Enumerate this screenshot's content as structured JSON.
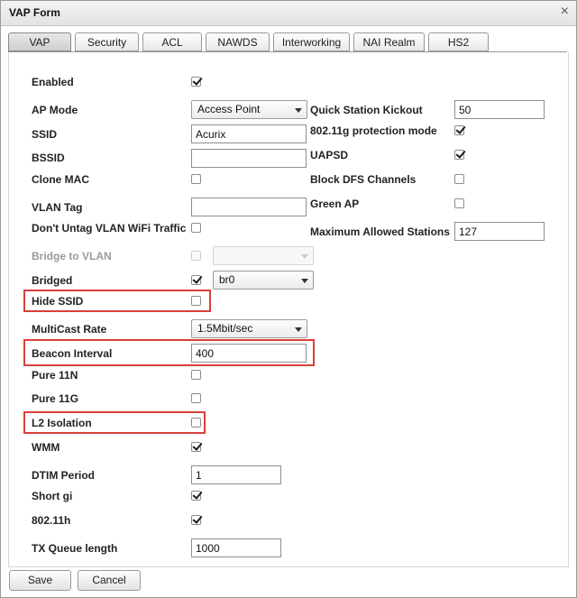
{
  "window": {
    "title": "VAP Form",
    "close_glyph": "×"
  },
  "tabs": [
    {
      "label": "VAP",
      "active": true
    },
    {
      "label": "Security"
    },
    {
      "label": "ACL"
    },
    {
      "label": "NAWDS"
    },
    {
      "label": "Interworking"
    },
    {
      "label": "NAI Realm"
    },
    {
      "label": "HS2"
    }
  ],
  "left": {
    "enabled": {
      "label": "Enabled",
      "checked": true
    },
    "ap_mode": {
      "label": "AP Mode",
      "value": "Access Point"
    },
    "ssid": {
      "label": "SSID",
      "value": "Acurix"
    },
    "bssid": {
      "label": "BSSID",
      "value": ""
    },
    "clone_mac": {
      "label": "Clone MAC",
      "checked": false
    },
    "vlan_tag": {
      "label": "VLAN Tag",
      "value": ""
    },
    "dont_untag": {
      "label": "Don't Untag VLAN WiFi Traffic",
      "checked": false
    },
    "bridge_to_vlan": {
      "label": "Bridge to VLAN",
      "checked": false,
      "disabled": true,
      "value": ""
    },
    "bridged": {
      "label": "Bridged",
      "checked": true,
      "value": "br0"
    },
    "hide_ssid": {
      "label": "Hide SSID",
      "checked": false
    },
    "multicast_rate": {
      "label": "MultiCast Rate",
      "value": "1.5Mbit/sec"
    },
    "beacon_interval": {
      "label": "Beacon Interval",
      "value": "400"
    },
    "pure_11n": {
      "label": "Pure 11N",
      "checked": false
    },
    "pure_11g": {
      "label": "Pure 11G",
      "checked": false
    },
    "l2_isolation": {
      "label": "L2 Isolation",
      "checked": false
    },
    "wmm": {
      "label": "WMM",
      "checked": true
    },
    "dtim_period": {
      "label": "DTIM Period",
      "value": "1"
    },
    "short_gi": {
      "label": "Short gi",
      "checked": true
    },
    "dot11h": {
      "label": "802.11h",
      "checked": true
    },
    "tx_queue_length": {
      "label": "TX Queue length",
      "value": "1000"
    }
  },
  "right": {
    "quick_station_kickout": {
      "label": "Quick Station Kickout",
      "value": "50"
    },
    "g_protection": {
      "label": "802.11g protection mode",
      "checked": true
    },
    "uapsd": {
      "label": "UAPSD",
      "checked": true
    },
    "block_dfs": {
      "label": "Block DFS Channels",
      "checked": false
    },
    "green_ap": {
      "label": "Green AP",
      "checked": false
    },
    "max_stations": {
      "label": "Maximum Allowed Stations",
      "value": "127"
    }
  },
  "buttons": {
    "save": "Save",
    "cancel": "Cancel"
  },
  "colors": {
    "highlight": "#d9403a",
    "disabled_text": "#9a9a9a"
  }
}
